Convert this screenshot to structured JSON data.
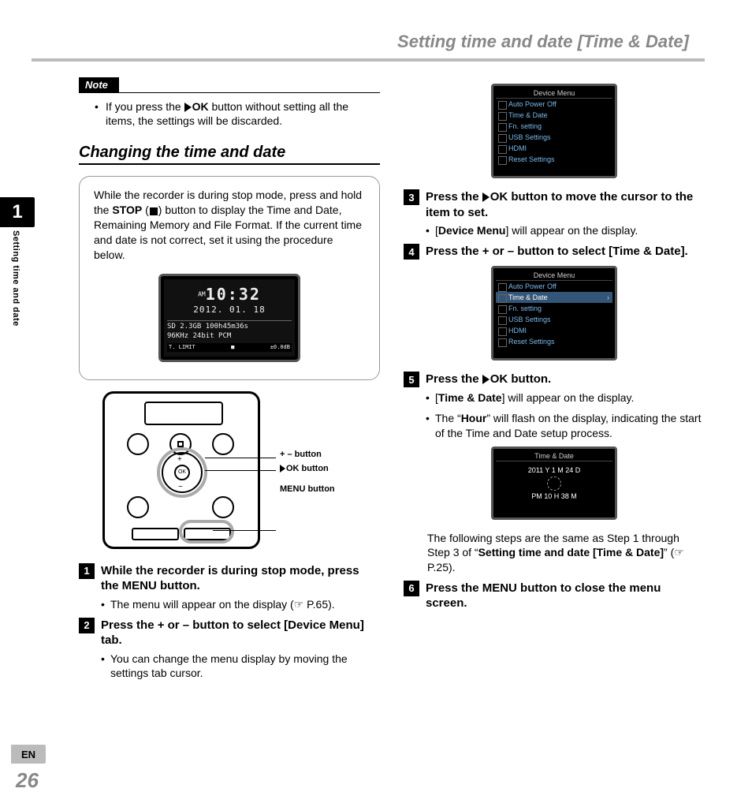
{
  "header": {
    "title": "Setting time and date [Time & Date]"
  },
  "sidebar": {
    "chapter_number": "1",
    "chapter_label": "Setting time and date"
  },
  "footer": {
    "lang": "EN",
    "page_number": "26"
  },
  "note": {
    "label": "Note",
    "body_pre": "If you press the ",
    "ok": "OK",
    "body_post": " button without setting all the items, the settings will be discarded."
  },
  "section_heading": "Changing the time and date",
  "callout": {
    "pre": "While the recorder is during stop mode, press and hold the ",
    "stop": "STOP",
    "mid": " (",
    "post": ") button to display the Time and Date, Remaining Memory and File Format. If the current time and date is not correct, set it using the procedure below."
  },
  "clock_screen": {
    "am": "AM",
    "time": "10:32",
    "date": "2012. 01. 18",
    "mem": "SD 2.3GB 100h45m36s",
    "fmt": "96KHz 24bit PCM",
    "bar_left": "T. LIMIT",
    "bar_right": "±0.0dB"
  },
  "device_labels": {
    "plus_minus": "+ – button",
    "ok": "OK button",
    "menu": "MENU button"
  },
  "device_menu_title": "Device Menu",
  "menu_items": [
    "Auto Power Off",
    "Time & Date",
    "Fn. setting",
    "USB Settings",
    "HDMI",
    "Reset Settings"
  ],
  "timedate_screen": {
    "title": "Time & Date",
    "line1": "2011 Y 1 M 24 D",
    "line2": "PM  10 H  38 M"
  },
  "steps": {
    "s1": {
      "text": "While the recorder is during stop mode, press the MENU button.",
      "sub": "The menu will appear on the display (☞ P.65)."
    },
    "s2": {
      "text_pre": "Press the + or – button to select [",
      "tab": "Device Menu",
      "text_post": "] tab.",
      "sub": "You can change the menu display by moving the settings tab cursor."
    },
    "s3": {
      "text_pre": "Press the ",
      "ok": "OK",
      "text_post": " button to move the cursor to the item to set.",
      "sub_pre": "[",
      "sub_b": "Device Menu",
      "sub_post": "] will appear on the display."
    },
    "s4": {
      "text_pre": "Press the + or – button to select [",
      "b": "Time & Date",
      "text_post": "]."
    },
    "s5": {
      "text_pre": "Press the ",
      "ok": "OK",
      "text_post": " button.",
      "sub1_pre": "[",
      "sub1_b": "Time & Date",
      "sub1_post": "] will appear on the display.",
      "sub2_pre": "The “",
      "sub2_b": "Hour",
      "sub2_post": "” will flash on the display, indicating the start of the Time and Date setup process."
    },
    "follow_pre": "The following steps are the same as Step 1 through Step 3 of “",
    "follow_b": "Setting time and date [Time & Date]",
    "follow_post": "” (☞ P.25).",
    "s6": {
      "text": "Press the MENU button to close the menu screen."
    }
  }
}
